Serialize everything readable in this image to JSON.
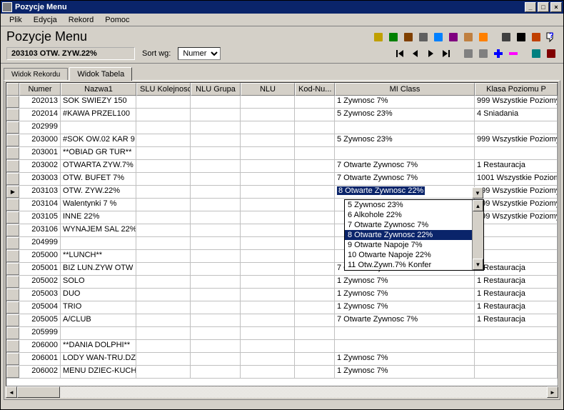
{
  "window": {
    "title": "Pozycje Menu"
  },
  "menu": {
    "items": [
      "Plik",
      "Edycja",
      "Rekord",
      "Pomoc"
    ]
  },
  "header": {
    "title": "Pozycje Menu",
    "record": "203103  OTW. ZYW.22%",
    "sort_label": "Sort wg:",
    "sort_value": "Numer"
  },
  "toolbar_icons_right": [
    "copy-icon",
    "cut-icon",
    "paste-icon",
    "delete-icon",
    "find-icon",
    "filter-icon",
    "clipboard-icon",
    "sort-icon",
    "print-icon",
    "binoculars-icon",
    "help-book-icon",
    "whats-this-icon"
  ],
  "nav_icons": [
    "first-icon",
    "prev-icon",
    "next-icon",
    "last-icon",
    "edit-icon",
    "undo-icon",
    "plus-icon",
    "minus-icon",
    "screen-icon",
    "exit-icon"
  ],
  "tabs": {
    "items": [
      "Widok Rekordu",
      "Widok Tabela"
    ],
    "active": 1
  },
  "grid": {
    "columns": [
      "Numer",
      "Nazwa1",
      "SLU Kolejnosc",
      "NLU Grupa",
      "NLU",
      "Kod-Nu...",
      "MI Class",
      "Klasa Poziomu P"
    ],
    "rows": [
      {
        "num": "202013",
        "naz": "SOK SWIEZY 150",
        "mi": "1  Zywnosc 7%",
        "kl": "999  Wszystkie Poziomy"
      },
      {
        "num": "202014",
        "naz": "#KAWA PRZEL100",
        "mi": "5  Zywnosc 23%",
        "kl": "4  Sniadania"
      },
      {
        "num": "202999",
        "naz": "",
        "mi": "",
        "kl": ""
      },
      {
        "num": "203000",
        "naz": "#SOK OW.02 KAR 9",
        "mi": "5  Zywnosc 23%",
        "kl": "999  Wszystkie Poziomy"
      },
      {
        "num": "203001",
        "naz": "**OBIAD GR TUR**",
        "mi": "",
        "kl": ""
      },
      {
        "num": "203002",
        "naz": "OTWARTA ZYW.7%",
        "mi": "7  Otwarte Zywnosc 7%",
        "kl": "1  Restauracja"
      },
      {
        "num": "203003",
        "naz": "OTW. BUFET 7%",
        "mi": "7  Otwarte Zywnosc 7%",
        "kl": "1001  Wszystkie Poziom"
      },
      {
        "num": "203103",
        "naz": "OTW. ZYW.22%",
        "mi": "8  Otwarte Zywnosc 22%",
        "kl": "999  Wszystkie Poziomy",
        "current": true,
        "selected": true
      },
      {
        "num": "203104",
        "naz": "Walentynki  7 %",
        "mi": "",
        "kl": "999  Wszystkie Poziomy"
      },
      {
        "num": "203105",
        "naz": "INNE 22%",
        "mi": "",
        "kl": "999  Wszystkie Poziomy"
      },
      {
        "num": "203106",
        "naz": "WYNAJEM SAL 22%",
        "mi": "",
        "kl": ""
      },
      {
        "num": "204999",
        "naz": "",
        "mi": "",
        "kl": ""
      },
      {
        "num": "205000",
        "naz": "**LUNCH**",
        "mi": "",
        "kl": ""
      },
      {
        "num": "205001",
        "naz": "BIZ LUN.ZYW OTW",
        "mi": "7  Otwarte Zywnosc 7%",
        "kl": "1  Restauracja"
      },
      {
        "num": "205002",
        "naz": "SOLO",
        "mi": "1  Zywnosc 7%",
        "kl": "1  Restauracja"
      },
      {
        "num": "205003",
        "naz": "DUO",
        "mi": "1  Zywnosc 7%",
        "kl": "1  Restauracja"
      },
      {
        "num": "205004",
        "naz": "TRIO",
        "mi": "1  Zywnosc 7%",
        "kl": "1  Restauracja"
      },
      {
        "num": "205005",
        "naz": "A/CLUB",
        "mi": "7  Otwarte Zywnosc 7%",
        "kl": "1  Restauracja"
      },
      {
        "num": "205999",
        "naz": "",
        "mi": "",
        "kl": ""
      },
      {
        "num": "206000",
        "naz": "**DANIA DOLPHI**",
        "mi": "",
        "kl": ""
      },
      {
        "num": "206001",
        "naz": "LODY WAN-TRU.DZ",
        "mi": "1  Zywnosc 7%",
        "kl": ""
      },
      {
        "num": "206002",
        "naz": "MENU DZIEC-KUCH",
        "mi": "1  Zywnosc 7%",
        "kl": ""
      }
    ]
  },
  "dropdown": {
    "items": [
      {
        "label": "5  Zywnosc 23%"
      },
      {
        "label": "6  Alkohole 22%"
      },
      {
        "label": "7  Otwarte Zywnosc 7%"
      },
      {
        "label": "8  Otwarte Zywnosc 22%",
        "sel": true
      },
      {
        "label": "9  Otwarte Napoje 7%"
      },
      {
        "label": "10  Otwarte Napoje 22%"
      },
      {
        "label": "11  Otw.Zywn.7% Konfer"
      }
    ]
  }
}
